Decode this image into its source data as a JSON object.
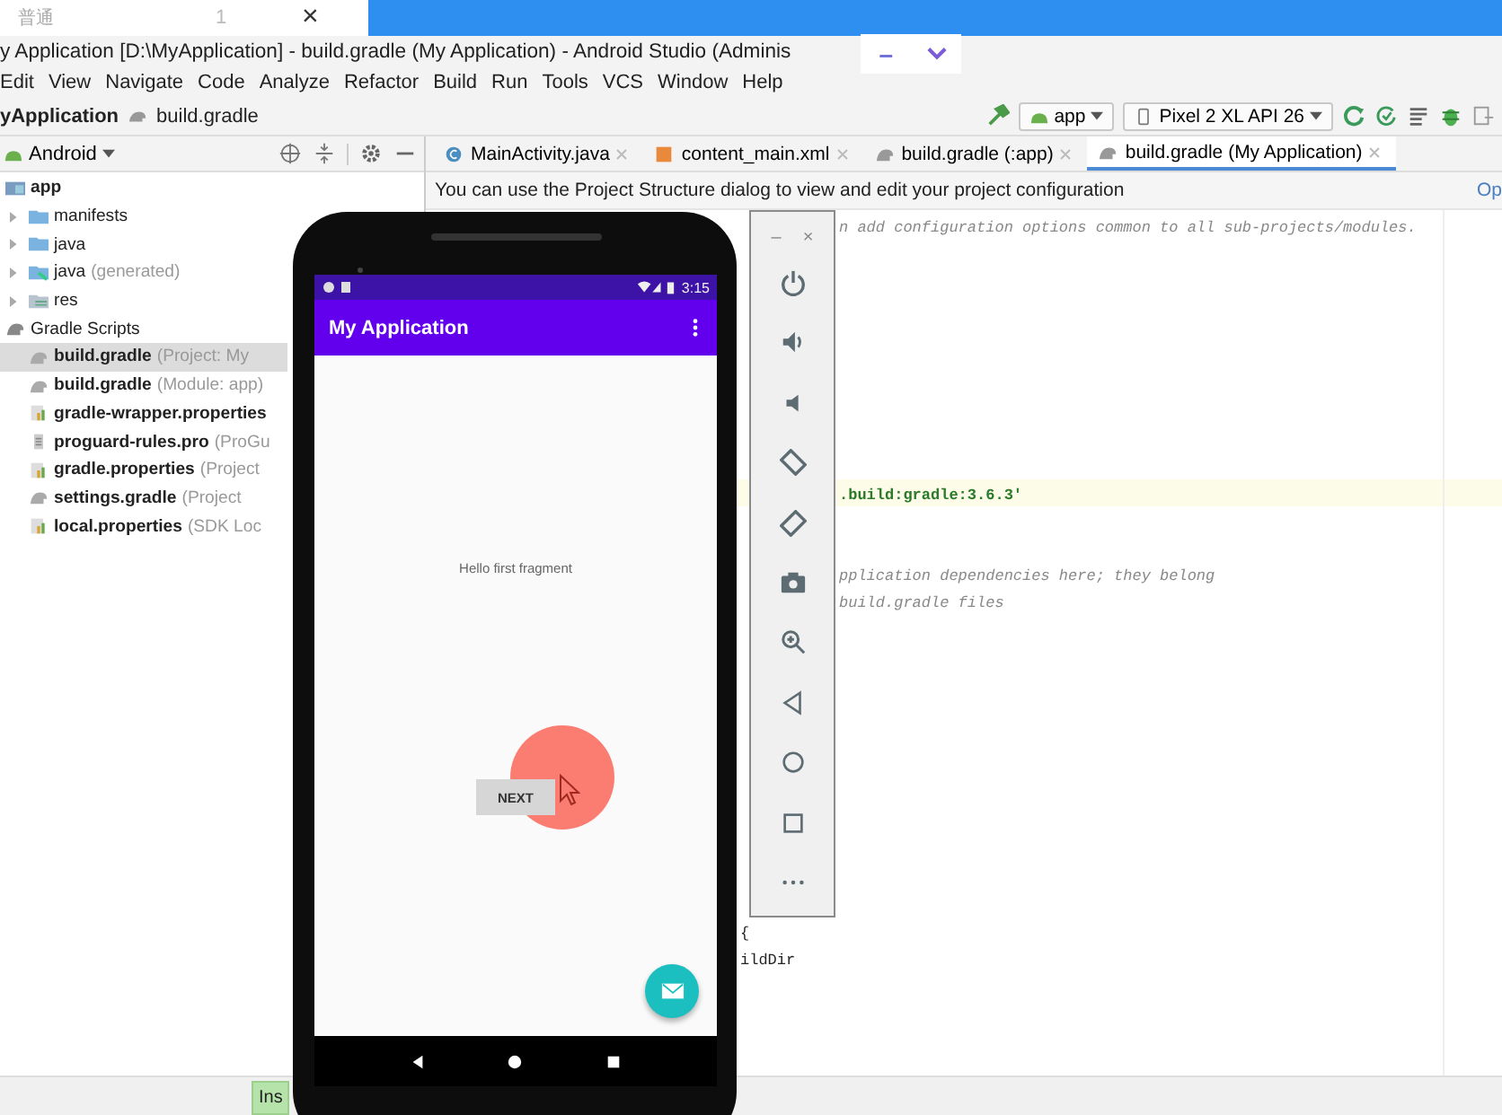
{
  "top_strip": {
    "tab_label": "普通",
    "tab_number": "1",
    "close": "×"
  },
  "window": {
    "title": "y Application [D:\\MyApplication] - build.gradle (My Application) - Android Studio (Adminis",
    "minimize": "–"
  },
  "menu": [
    "Edit",
    "View",
    "Navigate",
    "Code",
    "Analyze",
    "Refactor",
    "Build",
    "Run",
    "Tools",
    "VCS",
    "Window",
    "Help"
  ],
  "navbar": {
    "project": "yApplication",
    "file": "build.gradle",
    "run_config": "app",
    "device": "Pixel 2 XL API 26"
  },
  "project_panel": {
    "view": "Android",
    "tree": [
      {
        "label": "app",
        "kind": "module",
        "children": [
          {
            "label": "manifests",
            "kind": "folder",
            "expanded": false
          },
          {
            "label": "java",
            "kind": "folder",
            "expanded": false
          },
          {
            "label": "java",
            "hint": "(generated)",
            "kind": "generated",
            "expanded": false
          },
          {
            "label": "res",
            "kind": "res",
            "expanded": false
          }
        ]
      },
      {
        "label": "Gradle Scripts",
        "kind": "gradle",
        "children": [
          {
            "label": "build.gradle",
            "hint": "(Project: My",
            "kind": "gradle",
            "selected": true
          },
          {
            "label": "build.gradle",
            "hint": "(Module: app)",
            "kind": "gradle",
            "selected": false
          },
          {
            "label": "gradle-wrapper.properties",
            "kind": "properties",
            "selected": false
          },
          {
            "label": "proguard-rules.pro",
            "hint": "(ProGu",
            "kind": "file",
            "selected": false
          },
          {
            "label": "gradle.properties",
            "hint": "(Project",
            "kind": "properties",
            "selected": false
          },
          {
            "label": "settings.gradle",
            "hint": "(Project",
            "kind": "gradle",
            "selected": false
          },
          {
            "label": "local.properties",
            "hint": "(SDK Loc",
            "kind": "properties",
            "selected": false
          }
        ]
      }
    ]
  },
  "editor": {
    "tabs": [
      {
        "label": "MainActivity.java",
        "kind": "java",
        "selected": false
      },
      {
        "label": "content_main.xml",
        "kind": "xml",
        "selected": false
      },
      {
        "label": "build.gradle (:app)",
        "kind": "gradle",
        "selected": false
      },
      {
        "label": "build.gradle (My Application)",
        "kind": "gradle",
        "selected": true
      }
    ],
    "banner": {
      "text": "You can use the Project Structure dialog to view and edit your project configuration",
      "link": "Op"
    },
    "lines": [
      {
        "kind": "comment",
        "right": "n add configuration options common to all sub-projects/modules.",
        "highlighted": false
      },
      {
        "kind": "code",
        "right": ".build:gradle:3.6.3'",
        "highlighted": true
      },
      {
        "kind": "comment",
        "right": "pplication dependencies here; they belong",
        "highlighted": false
      },
      {
        "kind": "comment",
        "right": "build.gradle files",
        "highlighted": false
      },
      {
        "kind": "code",
        "left": "{",
        "highlighted": false
      },
      {
        "kind": "code",
        "left": "ildDir",
        "highlighted": false
      }
    ]
  },
  "status_bar": {
    "mode": "Ins"
  },
  "emulator": {
    "time": "3:15",
    "app_title": "My Application",
    "message": "Hello first fragment",
    "button": "NEXT",
    "toolbar": {
      "minimize": "–",
      "close": "×"
    }
  }
}
